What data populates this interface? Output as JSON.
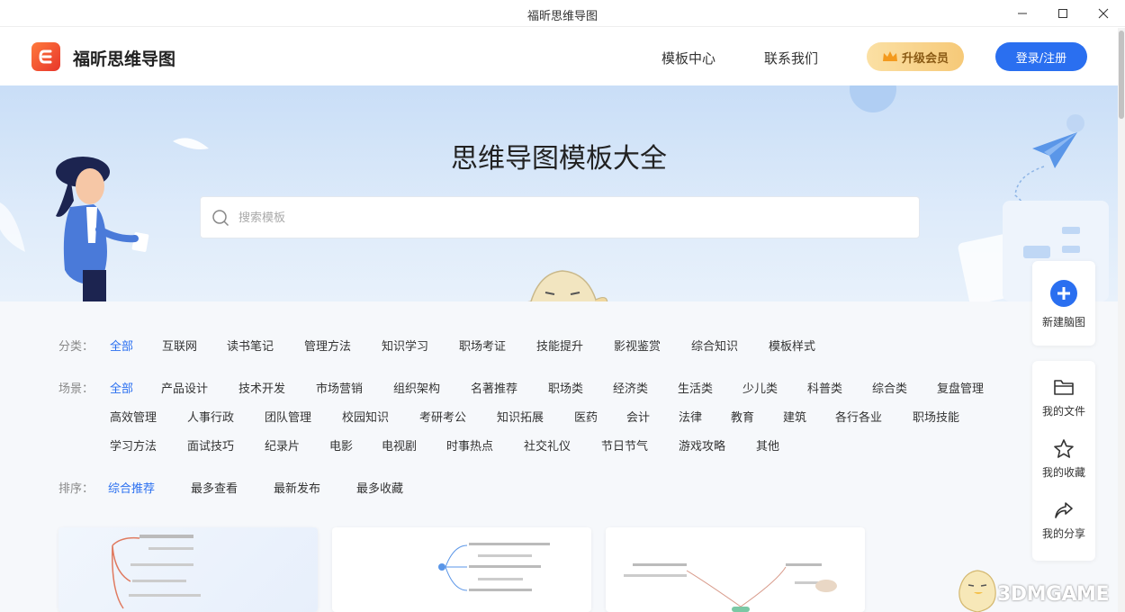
{
  "window": {
    "title": "福昕思维导图"
  },
  "header": {
    "brand": "福昕思维导图",
    "nav": [
      {
        "label": "模板中心"
      },
      {
        "label": "联系我们"
      }
    ],
    "vip_label": "升级会员",
    "login_label": "登录/注册"
  },
  "hero": {
    "title": "思维导图模板大全",
    "search_placeholder": "搜索模板"
  },
  "filters": {
    "category": {
      "label": "分类：",
      "items": [
        "全部",
        "互联网",
        "读书笔记",
        "管理方法",
        "知识学习",
        "职场考证",
        "技能提升",
        "影视鉴赏",
        "综合知识",
        "模板样式"
      ],
      "active": "全部"
    },
    "scene": {
      "label": "场景：",
      "rows": [
        [
          "全部",
          "产品设计",
          "技术开发",
          "市场营销",
          "组织架构",
          "名著推荐",
          "职场类",
          "经济类",
          "生活类",
          "少儿类",
          "科普类",
          "综合类",
          "复盘管理"
        ],
        [
          "高效管理",
          "人事行政",
          "团队管理",
          "校园知识",
          "考研考公",
          "知识拓展",
          "医药",
          "会计",
          "法律",
          "教育",
          "建筑",
          "各行各业",
          "职场技能"
        ],
        [
          "学习方法",
          "面试技巧",
          "纪录片",
          "电影",
          "电视剧",
          "时事热点",
          "社交礼仪",
          "节日节气",
          "游戏攻略",
          "其他"
        ]
      ],
      "active": "全部"
    },
    "sort": {
      "label": "排序：",
      "items": [
        "综合推荐",
        "最多查看",
        "最新发布",
        "最多收藏"
      ],
      "active": "综合推荐"
    }
  },
  "side_panel": {
    "new": "新建脑图",
    "items": [
      {
        "label": "我的文件",
        "icon": "folder-icon"
      },
      {
        "label": "我的收藏",
        "icon": "star-icon"
      },
      {
        "label": "我的分享",
        "icon": "share-icon"
      }
    ]
  },
  "watermark": "3DMGAME",
  "colors": {
    "accent": "#2a6ff0",
    "vip": "#f6c978",
    "logo": "#e7352b"
  }
}
